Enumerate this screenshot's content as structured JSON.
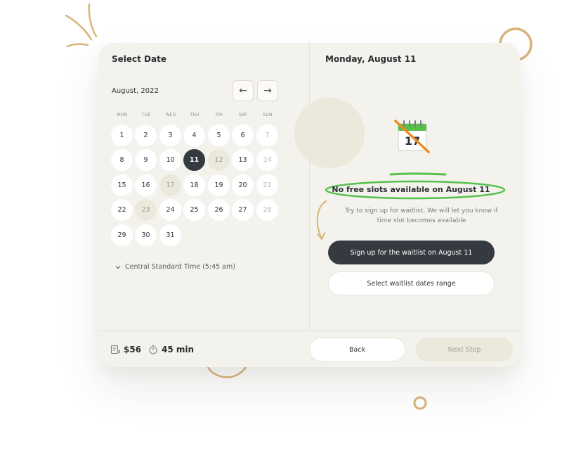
{
  "calendar": {
    "title": "Select Date",
    "month_label": "August, 2022",
    "prev_icon": "←",
    "next_icon": "→",
    "weekdays": [
      "MON",
      "TUE",
      "WED",
      "THU",
      "FRI",
      "SAT",
      "SUN"
    ],
    "days": [
      "1",
      "2",
      "3",
      "4",
      "5",
      "6",
      "7",
      "8",
      "9",
      "10",
      "11",
      "12",
      "13",
      "14",
      "15",
      "16",
      "17",
      "18",
      "19",
      "20",
      "21",
      "22",
      "23",
      "24",
      "25",
      "26",
      "27",
      "28",
      "29",
      "30",
      "31"
    ],
    "selected_day": "11",
    "timezone_label": "Central Standard Time (5:45 am)"
  },
  "detail": {
    "date_heading": "Monday, August 11",
    "no_slots_text": "No free slots available on August 11",
    "waitlist_hint": "Try to sign up for waitlist. We will let you know if time slot becomes available",
    "waitlist_button": "Sign up for the waitlist on August 11",
    "range_button": "Select waitlist dates range",
    "illustration_number": "17"
  },
  "footer": {
    "price": "$56",
    "duration": "45 min",
    "back_label": "Back",
    "next_label": "Next Step"
  },
  "colors": {
    "card_bg": "#f3f2ec",
    "dark": "#353a40",
    "accent_gold": "#d9b47a",
    "accent_green": "#55c04a",
    "strike_orange": "#f08a24"
  }
}
